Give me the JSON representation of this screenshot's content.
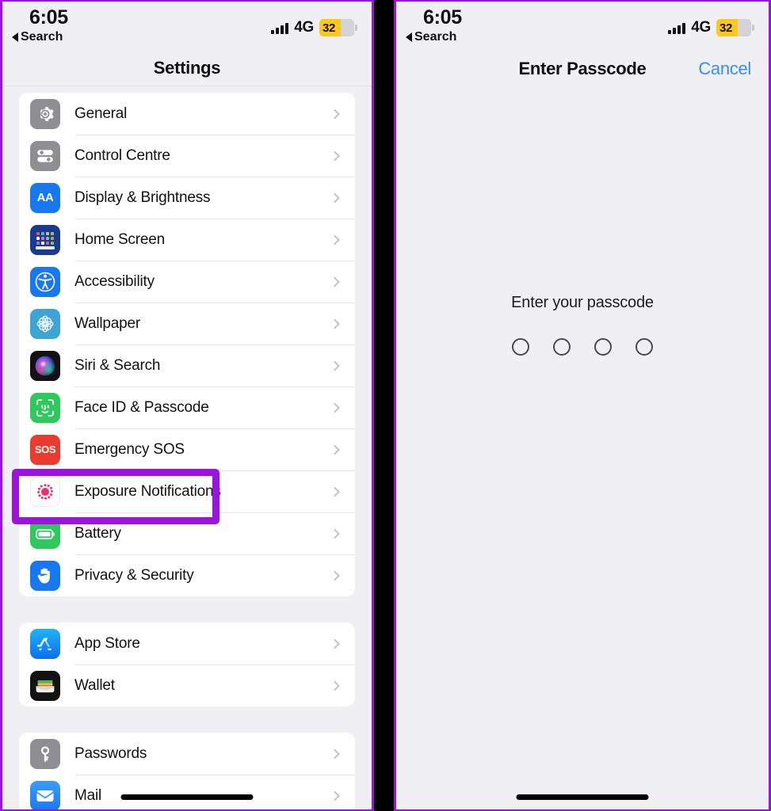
{
  "status_bar": {
    "time": "6:05",
    "back_label": "Search",
    "network": "4G",
    "battery_level": "32",
    "signal_icon": "cellular-signal-icon",
    "battery_icon": "battery-icon",
    "back_icon": "back-triangle-icon",
    "battery_fill_color": "#fbc81d"
  },
  "left_panel": {
    "nav_title": "Settings",
    "groups": [
      {
        "rows": [
          {
            "label": "General",
            "icon": "general-gear-icon"
          },
          {
            "label": "Control Centre",
            "icon": "control-centre-icon"
          },
          {
            "label": "Display & Brightness",
            "icon": "display-brightness-icon"
          },
          {
            "label": "Home Screen",
            "icon": "home-screen-icon"
          },
          {
            "label": "Accessibility",
            "icon": "accessibility-icon"
          },
          {
            "label": "Wallpaper",
            "icon": "wallpaper-icon"
          },
          {
            "label": "Siri & Search",
            "icon": "siri-search-icon"
          },
          {
            "label": "Face ID & Passcode",
            "icon": "face-id-icon"
          },
          {
            "label": "Emergency SOS",
            "icon": "emergency-sos-icon"
          },
          {
            "label": "Exposure Notifications",
            "icon": "exposure-notifications-icon"
          },
          {
            "label": "Battery",
            "icon": "battery-settings-icon"
          },
          {
            "label": "Privacy & Security",
            "icon": "privacy-security-icon"
          }
        ]
      },
      {
        "rows": [
          {
            "label": "App Store",
            "icon": "app-store-icon"
          },
          {
            "label": "Wallet",
            "icon": "wallet-icon"
          }
        ]
      },
      {
        "rows": [
          {
            "label": "Passwords",
            "icon": "passwords-key-icon"
          },
          {
            "label": "Mail",
            "icon": "mail-icon"
          }
        ]
      }
    ],
    "highlight": {
      "target_label": "Face ID & Passcode",
      "color": "#9b13dd"
    }
  },
  "right_panel": {
    "nav_title": "Enter Passcode",
    "cancel_label": "Cancel",
    "cancel_color": "#3b8cf7",
    "prompt": "Enter your passcode",
    "passcode_length": 4,
    "entered_digits": 0
  },
  "annotation": {
    "border_color": "#9b13dd"
  }
}
